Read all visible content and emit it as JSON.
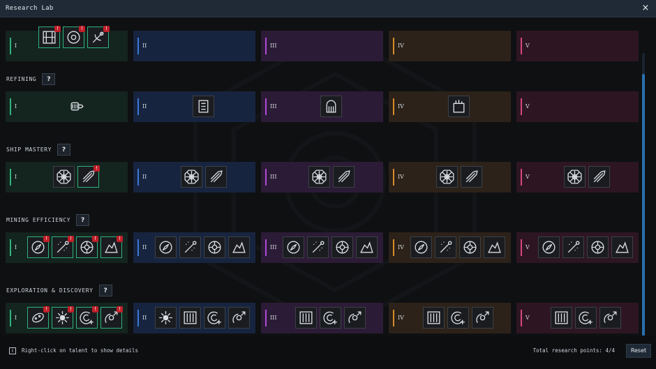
{
  "window": {
    "title": "Research Lab",
    "close_label": "×"
  },
  "tiers": [
    "I",
    "II",
    "III",
    "IV",
    "V"
  ],
  "sections": [
    {
      "key": "top",
      "label": "",
      "help": "?"
    },
    {
      "key": "refining",
      "label": "REFINING",
      "help": "?"
    },
    {
      "key": "ship_mastery",
      "label": "SHIP MASTERY",
      "help": "?"
    },
    {
      "key": "mining_efficiency",
      "label": "MINING EFFICIENCY",
      "help": "?"
    },
    {
      "key": "exploration",
      "label": "EXPLORATION & DISCOVERY",
      "help": "?"
    }
  ],
  "talent_badge": "!",
  "icon_names": {
    "top": [
      "circuit-board-icon",
      "reactor-core-icon",
      "satellite-dish-icon"
    ],
    "refining": [
      "drill-head-icon",
      "refinery-press-icon",
      "gas-canister-icon",
      "chemical-tank-icon"
    ],
    "ship_mastery": [
      "ship-wheel-icon",
      "thruster-boost-icon"
    ],
    "mining_efficiency": [
      "mining-compass-icon",
      "laser-drill-icon",
      "gear-wheel-icon",
      "ore-rock-icon"
    ],
    "exploration": [
      "asteroid-scanner-icon",
      "star-cluster-icon",
      "radar-add-icon",
      "probe-launch-icon",
      "data-columns-icon"
    ]
  },
  "footer": {
    "info_icon": "i",
    "hint": "Right-click on talent to show details",
    "points_label": "Total research points:",
    "points_value": "4/4",
    "reset_label": "Reset"
  },
  "colors": {
    "tier_I": "#2fb37e",
    "tier_II": "#3a78d6",
    "tier_III": "#b04ad6",
    "tier_IV": "#d78a2a",
    "tier_V": "#d8467f",
    "badge": "#c0202a"
  }
}
